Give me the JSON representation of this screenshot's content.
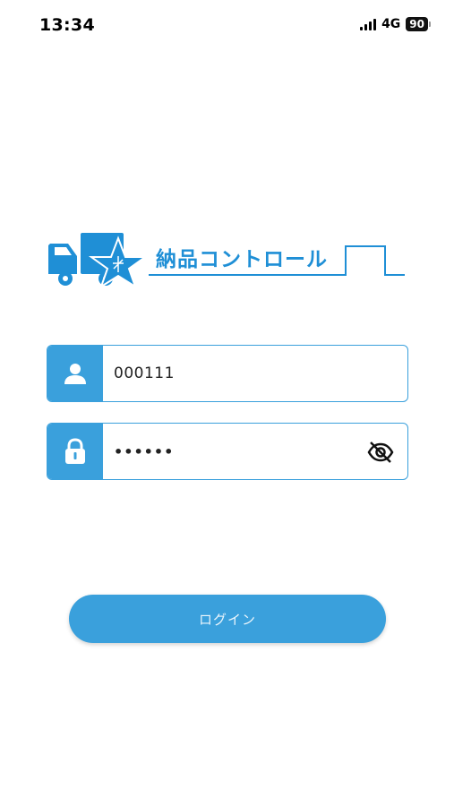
{
  "status_bar": {
    "time": "13:34",
    "network": "4G",
    "battery": "90"
  },
  "logo": {
    "text": "納品コントロール",
    "brand_color": "#1f8fd6"
  },
  "login_form": {
    "user_id": {
      "value": "000111",
      "icon": "user-icon"
    },
    "password": {
      "value": "••••••",
      "icon": "lock-icon",
      "toggle_icon": "eye-off-icon"
    },
    "login_button": "ログイン"
  },
  "colors": {
    "accent": "#3aa0dc"
  }
}
